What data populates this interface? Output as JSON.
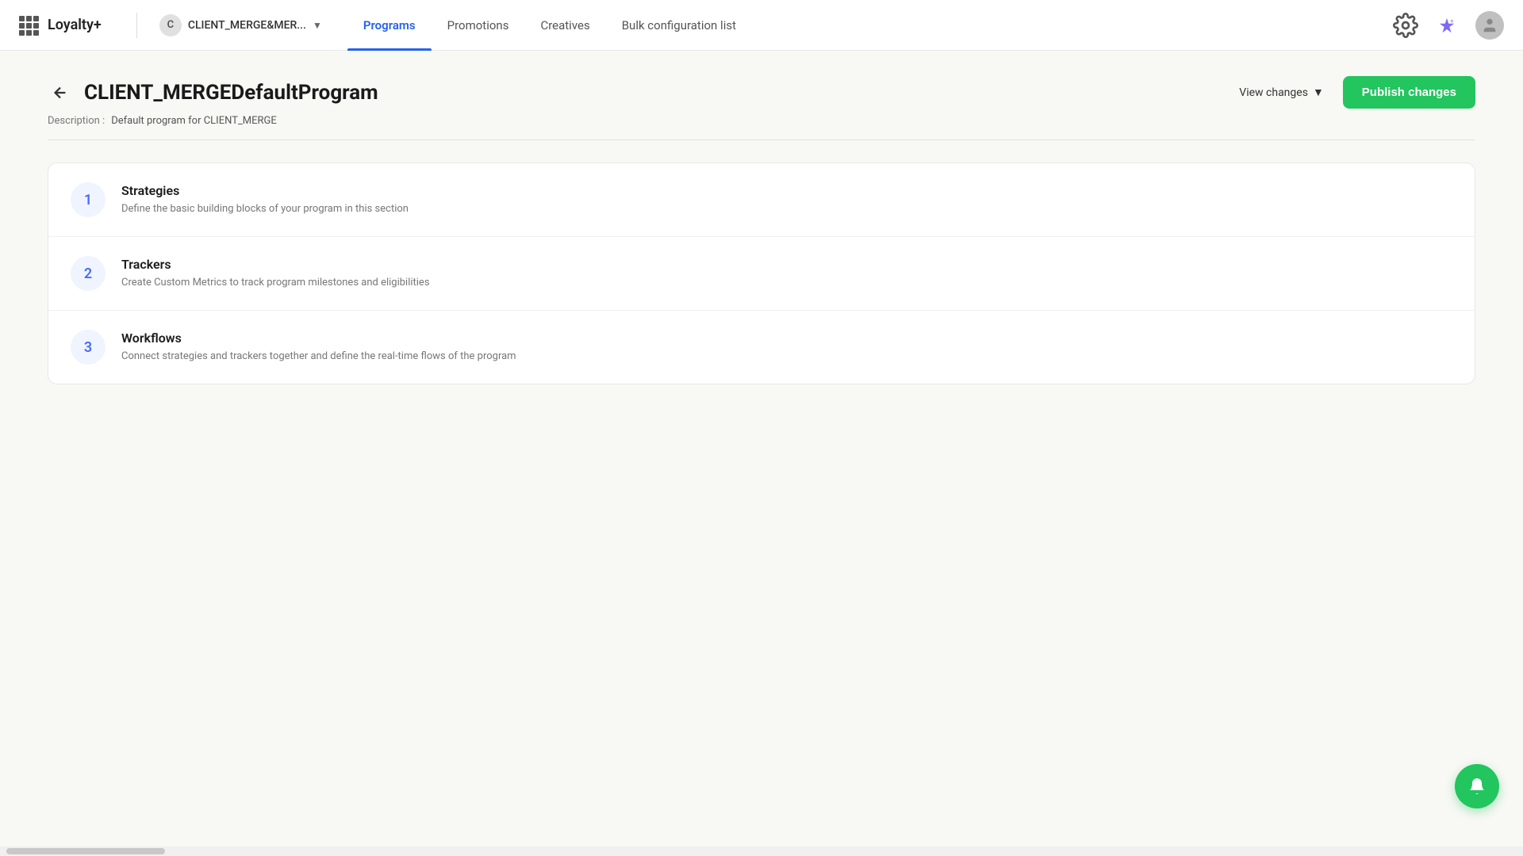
{
  "app": {
    "title": "Loyalty+",
    "grid_icon": "grid-icon"
  },
  "client": {
    "initial": "C",
    "name": "CLIENT_MERGE&MER..."
  },
  "nav": {
    "items": [
      {
        "label": "Programs",
        "active": true
      },
      {
        "label": "Promotions",
        "active": false
      },
      {
        "label": "Creatives",
        "active": false
      },
      {
        "label": "Bulk configuration list",
        "active": false
      }
    ]
  },
  "header_actions": {
    "settings_icon": "gear-icon",
    "sparkle_icon": "sparkle-icon",
    "user_icon": "user-icon"
  },
  "page": {
    "title": "CLIENT_MERGEDefaultProgram",
    "description_label": "Description :",
    "description_text": "Default program for CLIENT_MERGE",
    "view_changes_label": "View changes",
    "publish_label": "Publish changes"
  },
  "steps": [
    {
      "number": "1",
      "title": "Strategies",
      "description": "Define the basic building blocks of your program in this section"
    },
    {
      "number": "2",
      "title": "Trackers",
      "description": "Create Custom Metrics to track program milestones and eligibilities"
    },
    {
      "number": "3",
      "title": "Workflows",
      "description": "Connect strategies and trackers together and define the real-time flows of the program"
    }
  ]
}
